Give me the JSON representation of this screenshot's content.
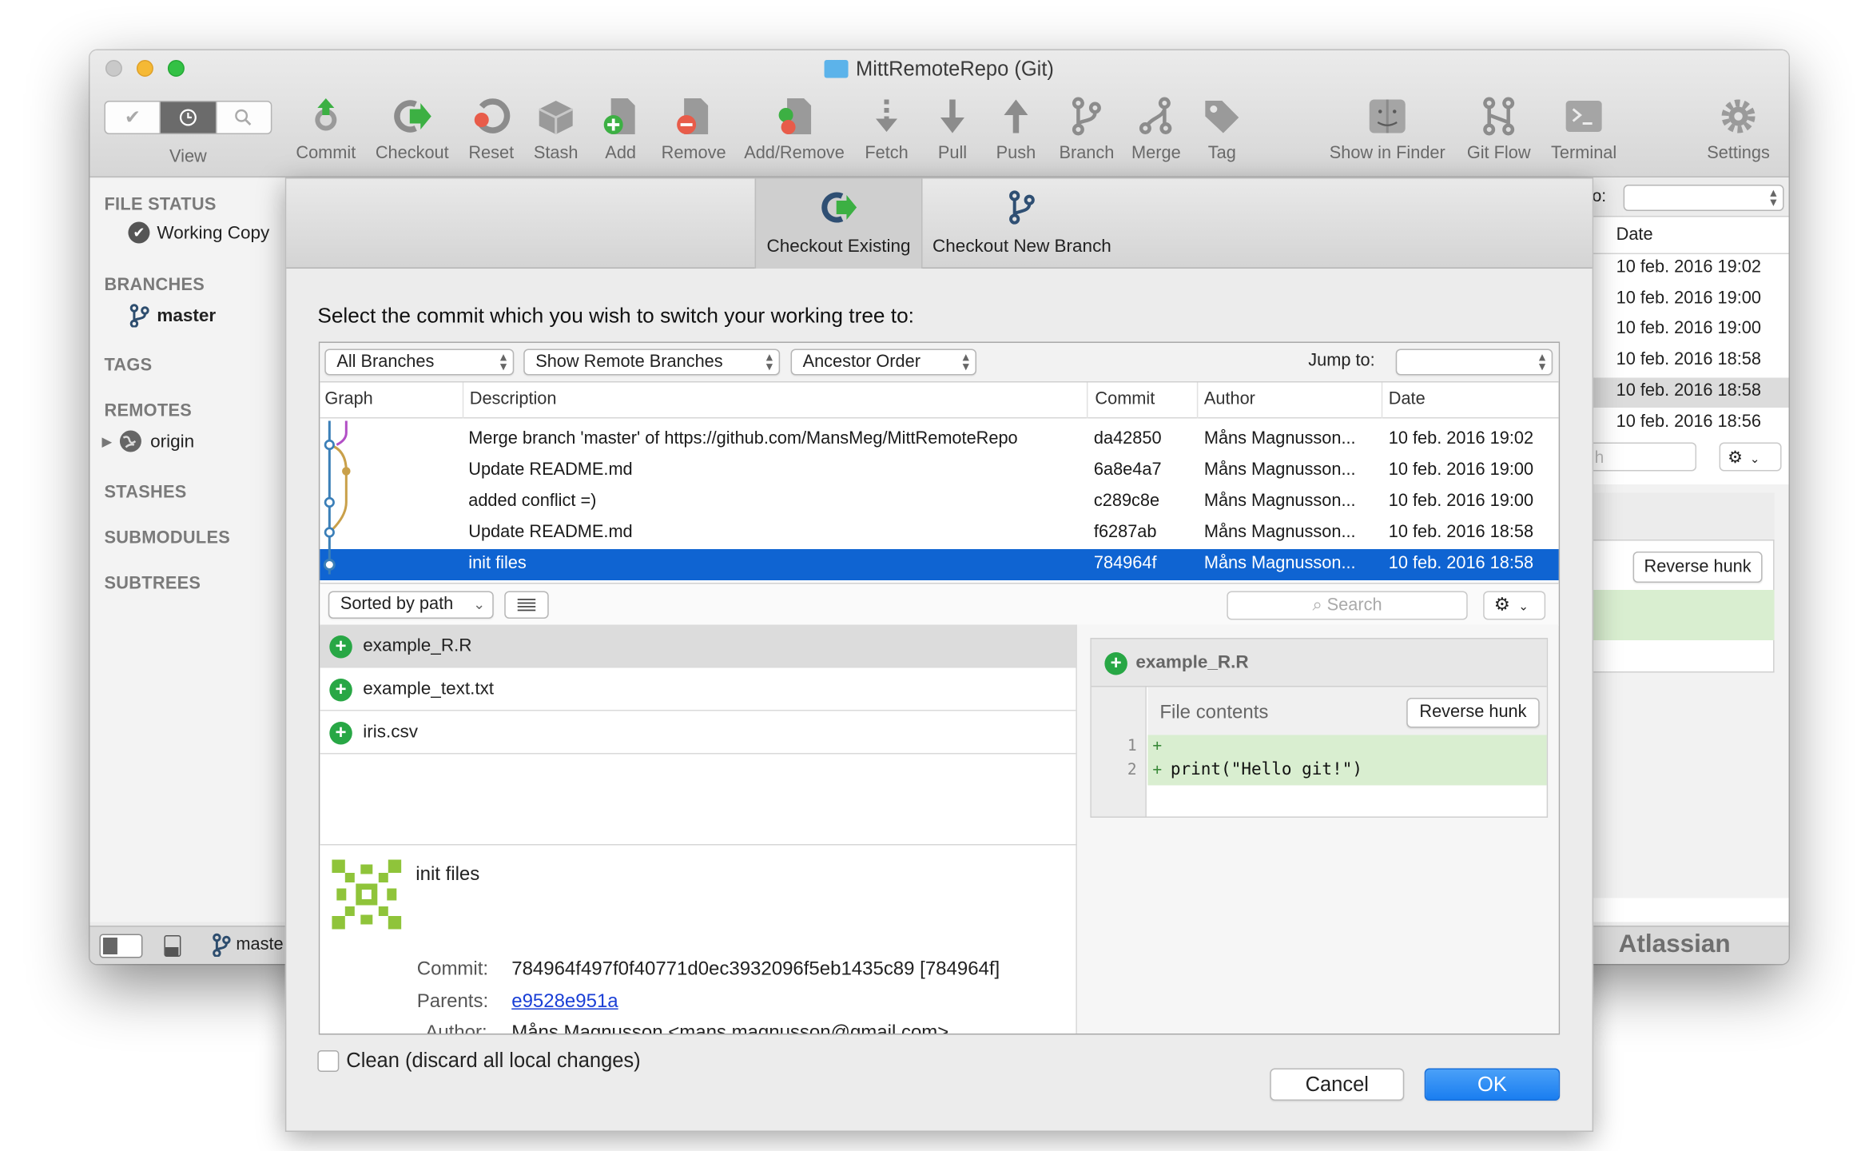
{
  "window": {
    "title": "MittRemoteRepo (Git)"
  },
  "toolbar": {
    "view_label": "View",
    "items": [
      {
        "label": "Commit",
        "icon": "commit-icon"
      },
      {
        "label": "Checkout",
        "icon": "checkout-icon"
      },
      {
        "label": "Reset",
        "icon": "reset-icon"
      },
      {
        "label": "Stash",
        "icon": "stash-icon"
      },
      {
        "label": "Add",
        "icon": "add-icon"
      },
      {
        "label": "Remove",
        "icon": "remove-icon"
      },
      {
        "label": "Add/Remove",
        "icon": "add-remove-icon"
      },
      {
        "label": "Fetch",
        "icon": "fetch-icon"
      },
      {
        "label": "Pull",
        "icon": "pull-icon"
      },
      {
        "label": "Push",
        "icon": "push-icon"
      },
      {
        "label": "Branch",
        "icon": "branch-icon"
      },
      {
        "label": "Merge",
        "icon": "merge-icon"
      },
      {
        "label": "Tag",
        "icon": "tag-icon"
      },
      {
        "label": "Show in Finder",
        "icon": "finder-icon"
      },
      {
        "label": "Git Flow",
        "icon": "git-flow-icon"
      },
      {
        "label": "Terminal",
        "icon": "terminal-icon"
      },
      {
        "label": "Settings",
        "icon": "gear-icon"
      }
    ]
  },
  "sidebar": {
    "file_status": "FILE STATUS",
    "working_copy": "Working Copy",
    "branches": "BRANCHES",
    "master": "master",
    "tags": "TAGS",
    "remotes": "REMOTES",
    "origin": "origin",
    "stashes": "STASHES",
    "submodules": "SUBMODULES",
    "subtrees": "SUBTREES"
  },
  "background": {
    "date_header": "Date",
    "jump_fragment": "o:",
    "dates": [
      "10 feb. 2016 19:02",
      "10 feb. 2016 19:00",
      "10 feb. 2016 19:00",
      "10 feb. 2016 18:58",
      "10 feb. 2016 18:58",
      "10 feb. 2016 18:56"
    ],
    "search_fragment": "h",
    "reverse_hunk": "Reverse hunk",
    "status_branch": "maste",
    "brand": "Atlassian"
  },
  "sheet": {
    "tabs": [
      {
        "label": "Checkout Existing"
      },
      {
        "label": "Checkout New Branch"
      }
    ],
    "prompt": "Select the commit which you wish to switch your working tree to:",
    "filters": {
      "branches": "All Branches",
      "remote": "Show Remote Branches",
      "order": "Ancestor Order",
      "jump_label": "Jump to:"
    },
    "columns": {
      "graph": "Graph",
      "description": "Description",
      "commit": "Commit",
      "author": "Author",
      "date": "Date"
    },
    "commits": [
      {
        "description": "Merge branch 'master' of https://github.com/MansMeg/MittRemoteRepo",
        "hash": "da42850",
        "author": "Måns Magnusson...",
        "date": "10 feb. 2016 19:02"
      },
      {
        "description": "Update README.md",
        "hash": "6a8e4a7",
        "author": "Måns Magnusson...",
        "date": "10 feb. 2016 19:00"
      },
      {
        "description": "added conflict =)",
        "hash": "c289c8e",
        "author": "Måns Magnusson...",
        "date": "10 feb. 2016 19:00"
      },
      {
        "description": "Update README.md",
        "hash": "f6287ab",
        "author": "Måns Magnusson...",
        "date": "10 feb. 2016 18:58"
      },
      {
        "description": "init files",
        "hash": "784964f",
        "author": "Måns Magnusson...",
        "date": "10 feb. 2016 18:58"
      }
    ],
    "sort_label": "Sorted by path",
    "search_placeholder": "Search",
    "files": [
      "example_R.R",
      "example_text.txt",
      "iris.csv"
    ],
    "commit_detail": {
      "subject": "init files",
      "commit_label": "Commit:",
      "commit_value": "784964f497f0f40771d0ec3932096f5eb1435c89 [784964f]",
      "parents_label": "Parents:",
      "parents_value": "e9528e951a",
      "author_label": "Author:",
      "author_value": "Måns Magnusson <mans.magnusson@gmail.com>"
    },
    "diff": {
      "file": "example_R.R",
      "header": "File contents",
      "reverse_hunk": "Reverse hunk",
      "lines": [
        {
          "num": "1",
          "sign": "+",
          "code": ""
        },
        {
          "num": "2",
          "sign": "+",
          "code": "print(\"Hello git!\")"
        }
      ]
    },
    "clean_label": "Clean (discard all local changes)",
    "cancel": "Cancel",
    "ok": "OK"
  }
}
